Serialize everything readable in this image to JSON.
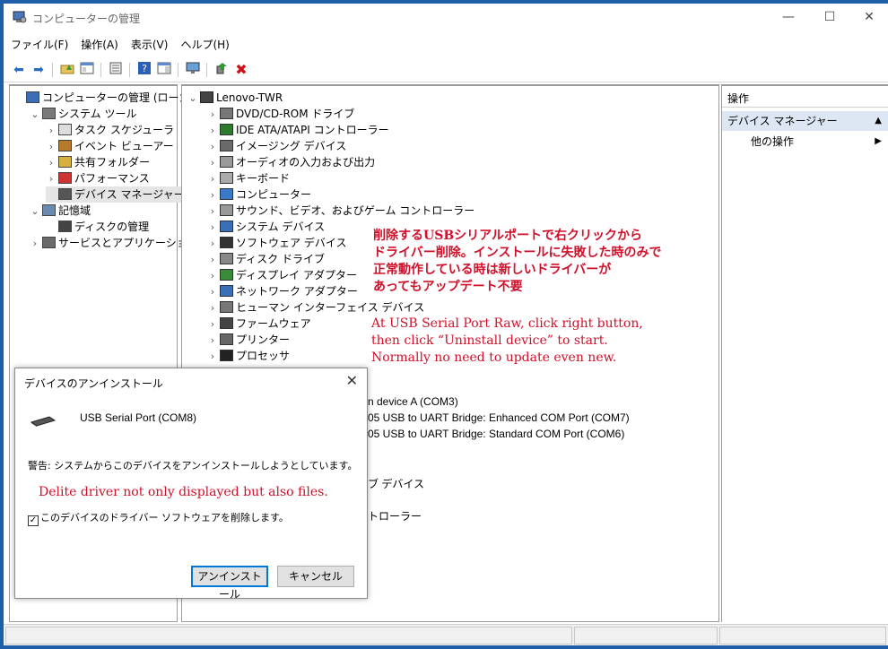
{
  "window": {
    "title": "コンピューターの管理",
    "minimize": "—",
    "maximize": "☐",
    "close": "✕"
  },
  "menu": [
    "ファイル(F)",
    "操作(A)",
    "表示(V)",
    "ヘルプ(H)"
  ],
  "toolbar_icons": [
    "back-icon",
    "forward-icon",
    "up-folder-icon",
    "show-tree-icon",
    "properties-icon",
    "help-icon",
    "view-icon",
    "monitor-icon",
    "update-driver-icon",
    "delete-icon"
  ],
  "left_tree": [
    {
      "label": "コンピューターの管理 (ローカル)",
      "indent": 0,
      "chevron": "",
      "icon": "computer-management-icon"
    },
    {
      "label": "システム ツール",
      "indent": 1,
      "chevron": "⌄",
      "icon": "system-tools-icon"
    },
    {
      "label": "タスク スケジューラ",
      "indent": 2,
      "chevron": "›",
      "icon": "clock-icon"
    },
    {
      "label": "イベント ビューアー",
      "indent": 2,
      "chevron": "›",
      "icon": "event-viewer-icon"
    },
    {
      "label": "共有フォルダー",
      "indent": 2,
      "chevron": "›",
      "icon": "shared-folder-icon"
    },
    {
      "label": "パフォーマンス",
      "indent": 2,
      "chevron": "›",
      "icon": "performance-icon"
    },
    {
      "label": "デバイス マネージャー",
      "indent": 2,
      "chevron": "",
      "icon": "device-manager-icon",
      "selected": true
    },
    {
      "label": "記憶域",
      "indent": 1,
      "chevron": "⌄",
      "icon": "storage-icon"
    },
    {
      "label": "ディスクの管理",
      "indent": 2,
      "chevron": "",
      "icon": "disk-management-icon"
    },
    {
      "label": "サービスとアプリケーション",
      "indent": 1,
      "chevron": "›",
      "icon": "services-icon"
    }
  ],
  "device_tree": {
    "root": "Lenovo-TWR",
    "categories": [
      "DVD/CD-ROM ドライブ",
      "IDE ATA/ATAPI コントローラー",
      "イメージング デバイス",
      "オーディオの入力および出力",
      "キーボード",
      "コンピューター",
      "サウンド、ビデオ、およびゲーム コントローラー",
      "システム デバイス",
      "ソフトウェア デバイス",
      "ディスク ドライブ",
      "ディスプレイ アダプター",
      "ネットワーク アダプター",
      "ヒューマン インターフェイス デバイス",
      "ファームウェア",
      "プリンター",
      "プロセッサ"
    ],
    "partial_rows": [
      "n device A (COM3)",
      "05 USB to UART Bridge: Enhanced COM Port (COM7)",
      "05 USB to UART Bridge: Standard COM Port (COM6)",
      "ブ デバイス",
      "トローラー"
    ]
  },
  "actions_pane": {
    "header": "操作",
    "section": "デバイス マネージャー",
    "item": "他の操作"
  },
  "annotation_jp": [
    "削除するUSBシリアルポートで右クリックから",
    "ドライバー削除。インストールに失敗した時のみで",
    "正常動作している時は新しいドライバーが",
    "あってもアップデート不要"
  ],
  "annotation_en": [
    "At USB Serial Port Raw, click right button,",
    "then click “Uninstall device” to start.",
    "Normally no need to update even new."
  ],
  "dialog": {
    "title": "デバイスのアンインストール",
    "device_name": "USB Serial Port (COM8)",
    "warning": "警告: システムからこのデバイスをアンインストールしようとしています。",
    "note": "Delite driver not only displayed but also files.",
    "checkbox_label": "このデバイスのドライバー ソフトウェアを削除します。",
    "checkbox_checked": true,
    "checkmark": "✓",
    "uninstall_button": "アンインストール",
    "cancel_button": "キャンセル"
  }
}
